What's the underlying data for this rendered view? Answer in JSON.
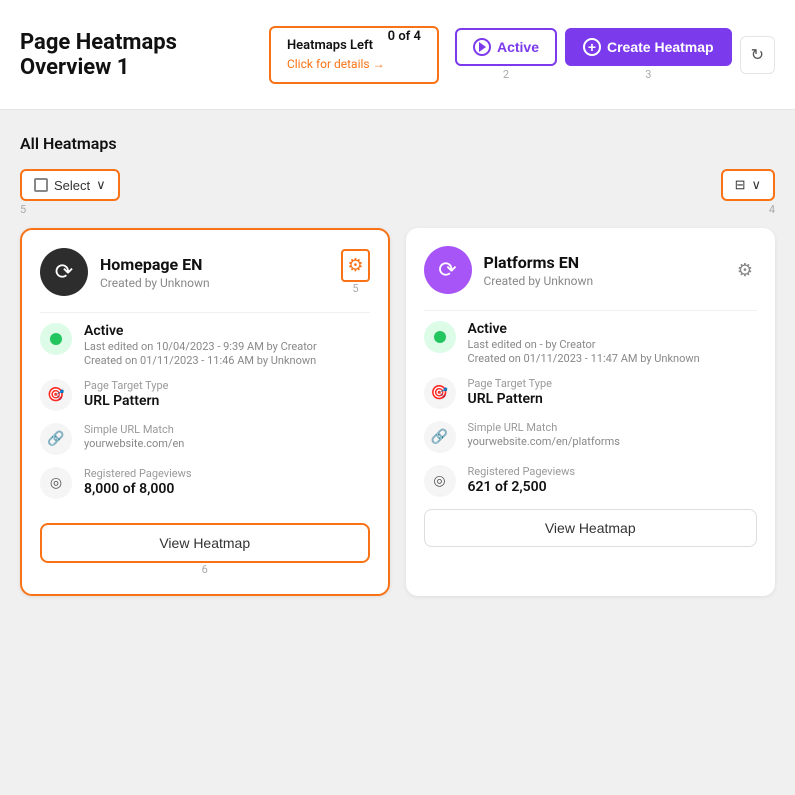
{
  "header": {
    "title": "Page Heatmaps Overview 1",
    "heatmaps_left": {
      "label": "Heatmaps Left",
      "link_text": "Click for details →",
      "count": "0 of 4"
    },
    "btn_active_label": "Active",
    "btn_create_label": "Create Heatmap",
    "badge_2": "2",
    "badge_3": "3"
  },
  "main": {
    "section_title": "All Heatmaps",
    "select_label": "Select",
    "filter_icon": "⊞",
    "badge_4": "4",
    "badge_5_top": "5",
    "badge_5_bottom": "5",
    "badge_6": "6",
    "cards": [
      {
        "name": "Homepage EN",
        "created_by": "Created by Unknown",
        "status": "Active",
        "last_edited": "Last edited on 10/04/2023 - 9:39 AM by Creator",
        "created_on": "Created on 01/11/2023 - 11:46 AM by Unknown",
        "page_target_label": "Page Target Type",
        "page_target_value": "URL Pattern",
        "url_match_label": "Simple URL Match",
        "url_match_value": "yourwebsite.com/en",
        "pageviews_label": "Registered Pageviews",
        "pageviews_value": "8,000 of 8,000",
        "view_btn": "View Heatmap",
        "highlighted": true
      },
      {
        "name": "Platforms EN",
        "created_by": "Created by Unknown",
        "status": "Active",
        "last_edited": "Last edited on - by Creator",
        "created_on": "Created on 01/11/2023 - 11:47 AM by Unknown",
        "page_target_label": "Page Target Type",
        "page_target_value": "URL Pattern",
        "url_match_label": "Simple URL Match",
        "url_match_value": "yourwebsite.com/en/platforms",
        "pageviews_label": "Registered Pageviews",
        "pageviews_value": "621 of 2,500",
        "view_btn": "View Heatmap",
        "highlighted": false
      }
    ]
  }
}
